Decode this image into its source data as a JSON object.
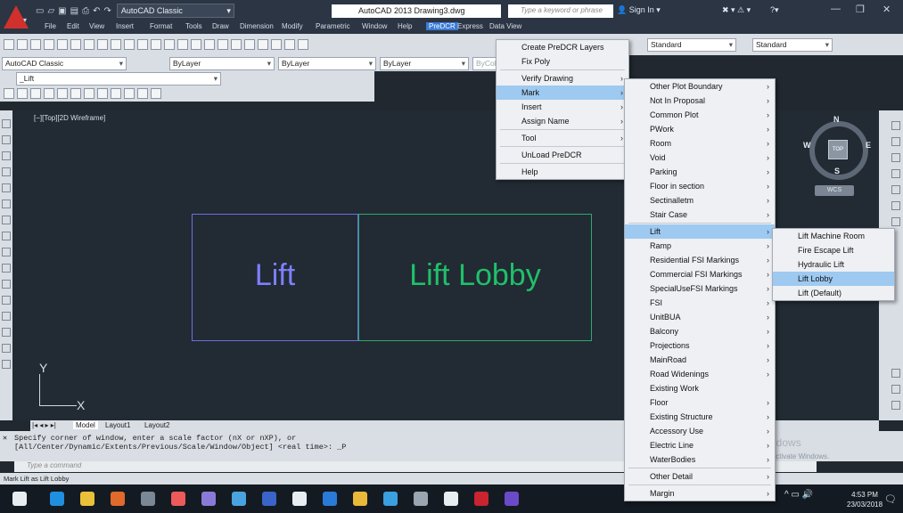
{
  "title": {
    "workspace": "AutoCAD Classic",
    "app_doc": "AutoCAD 2013   Drawing3.dwg",
    "keyword_placeholder": "Type a keyword or phrase",
    "signin": "Sign In"
  },
  "menubar": [
    "File",
    "Edit",
    "View",
    "Insert",
    "Format",
    "Tools",
    "Draw",
    "Dimension",
    "Modify",
    "Parametric",
    "Window",
    "Help",
    "PreDCR",
    "Express",
    "Data View"
  ],
  "toolbar": {
    "workspace": "AutoCAD Classic",
    "layer": "ByLayer",
    "linetype": "ByLayer",
    "lineweight": "ByLayer",
    "plotstyle": "ByColor",
    "style1": "Standard",
    "style2": "Standard",
    "layer_current": "_Lift"
  },
  "viewport_label": "[−][Top][2D Wireframe]",
  "drawing": {
    "lift": "Lift",
    "lobby": "Lift Lobby",
    "ucs_y": "Y",
    "ucs_x": "X"
  },
  "viewcube": {
    "n": "N",
    "s": "S",
    "e": "E",
    "w": "W",
    "top": "TOP",
    "wcs": "WCS"
  },
  "layout_tabs": [
    "Model",
    "Layout1",
    "Layout2"
  ],
  "command": {
    "line1": "Specify corner of window, enter a scale factor (nX or nXP), or",
    "line2": "[All/Center/Dynamic/Extents/Previous/Scale/Window/Object] <real time>: _P",
    "placeholder": "Type a command"
  },
  "status": "Mark Lift as Lift Lobby",
  "watermark": {
    "line1": "Activate Windows",
    "line2": "Go to Settings to activate Windows."
  },
  "clock": {
    "time": "4:53 PM",
    "date": "23/03/2018"
  },
  "menu_predcr": [
    {
      "label": "Create PreDCR Layers",
      "sub": false
    },
    {
      "label": "Fix Poly",
      "sub": false,
      "sep": true
    },
    {
      "label": "Verify Drawing",
      "sub": true
    },
    {
      "label": "Mark",
      "sub": true,
      "hl": true
    },
    {
      "label": "Insert",
      "sub": true
    },
    {
      "label": "Assign Name",
      "sub": true,
      "sep": true
    },
    {
      "label": "Tool",
      "sub": true,
      "sep": true
    },
    {
      "label": "UnLoad PreDCR",
      "sub": false,
      "sep": true
    },
    {
      "label": "Help",
      "sub": false
    }
  ],
  "menu_mark": [
    {
      "label": "Other Plot Boundary",
      "sub": true
    },
    {
      "label": "Not In Proposal",
      "sub": true
    },
    {
      "label": "Common Plot",
      "sub": true
    },
    {
      "label": "PWork",
      "sub": true
    },
    {
      "label": "Room",
      "sub": true
    },
    {
      "label": "Void",
      "sub": true
    },
    {
      "label": "Parking",
      "sub": true
    },
    {
      "label": "Floor in section",
      "sub": true
    },
    {
      "label": "Sectinalletm",
      "sub": true
    },
    {
      "label": "Stair Case",
      "sub": true,
      "sep": true
    },
    {
      "label": "Lift",
      "sub": true,
      "hl": true
    },
    {
      "label": "Ramp",
      "sub": true
    },
    {
      "label": "Residential FSI Markings",
      "sub": true
    },
    {
      "label": "Commercial FSI Markings",
      "sub": true
    },
    {
      "label": "SpecialUseFSI Markings",
      "sub": true
    },
    {
      "label": "FSI",
      "sub": true
    },
    {
      "label": "UnitBUA",
      "sub": true
    },
    {
      "label": "Balcony",
      "sub": true
    },
    {
      "label": "Projections",
      "sub": true
    },
    {
      "label": "MainRoad",
      "sub": true
    },
    {
      "label": "Road Widenings",
      "sub": true
    },
    {
      "label": "Existing Work",
      "sub": false
    },
    {
      "label": "Floor",
      "sub": true
    },
    {
      "label": "Existing Structure",
      "sub": true
    },
    {
      "label": "Accessory Use",
      "sub": true
    },
    {
      "label": "Electric Line",
      "sub": true
    },
    {
      "label": "WaterBodies",
      "sub": true,
      "sep": true
    },
    {
      "label": "Other Detail",
      "sub": true,
      "sep": true
    },
    {
      "label": "Margin",
      "sub": true
    }
  ],
  "menu_lift": [
    {
      "label": "Lift Machine Room"
    },
    {
      "label": "Fire Escape Lift"
    },
    {
      "label": "Hydraulic Lift"
    },
    {
      "label": "Lift Lobby",
      "hl": true
    },
    {
      "label": "Lift (Default)"
    }
  ]
}
